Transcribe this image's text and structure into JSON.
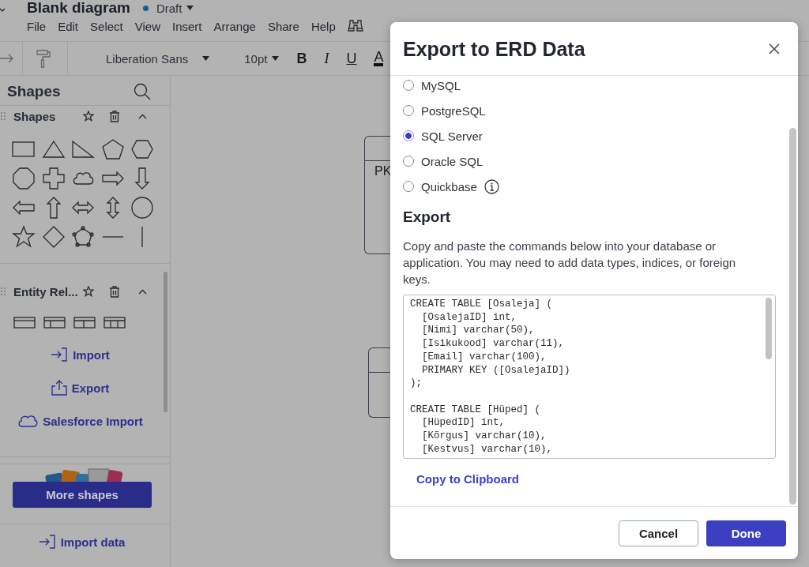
{
  "document": {
    "title": "Blank diagram",
    "status": "Draft"
  },
  "menu": [
    "File",
    "Edit",
    "Select",
    "View",
    "Insert",
    "Arrange",
    "Share",
    "Help"
  ],
  "toolbar": {
    "font": "Liberation Sans",
    "font_size": "10pt",
    "format_buttons": [
      "B",
      "I",
      "U",
      "A"
    ]
  },
  "sidebar": {
    "title": "Shapes",
    "sections": [
      {
        "title": "Shapes",
        "expanded": true
      },
      {
        "title": "Entity Rel...",
        "expanded": true
      }
    ],
    "links": [
      "Import",
      "Export",
      "Salesforce Import"
    ],
    "more_button": "More shapes",
    "import_data": "Import data"
  },
  "canvas": {
    "entity_label": "PK"
  },
  "dialog": {
    "title": "Export to ERD Data",
    "options": [
      {
        "label": "MySQL",
        "selected": false,
        "info": false
      },
      {
        "label": "PostgreSQL",
        "selected": false,
        "info": false
      },
      {
        "label": "SQL Server",
        "selected": true,
        "info": false
      },
      {
        "label": "Oracle SQL",
        "selected": false,
        "info": false
      },
      {
        "label": "Quickbase",
        "selected": false,
        "info": true
      }
    ],
    "export_heading": "Export",
    "description": "Copy and paste the commands below into your database or application. You may need to add data types, indices, or foreign keys.",
    "code": "CREATE TABLE [Osaleja] (\n  [OsalejaID] int,\n  [Nimi] varchar(50),\n  [Isikukood] varchar(11),\n  [Email] varchar(100),\n  PRIMARY KEY ([OsalejaID])\n);\n\nCREATE TABLE [Hüped] (\n  [HüpedID] int,\n  [Kõrgus] varchar(10),\n  [Kestvus] varchar(10),",
    "copy_link": "Copy to Clipboard",
    "buttons": [
      {
        "label": "Cancel",
        "kind": "secondary"
      },
      {
        "label": "Done",
        "kind": "primary"
      }
    ]
  }
}
